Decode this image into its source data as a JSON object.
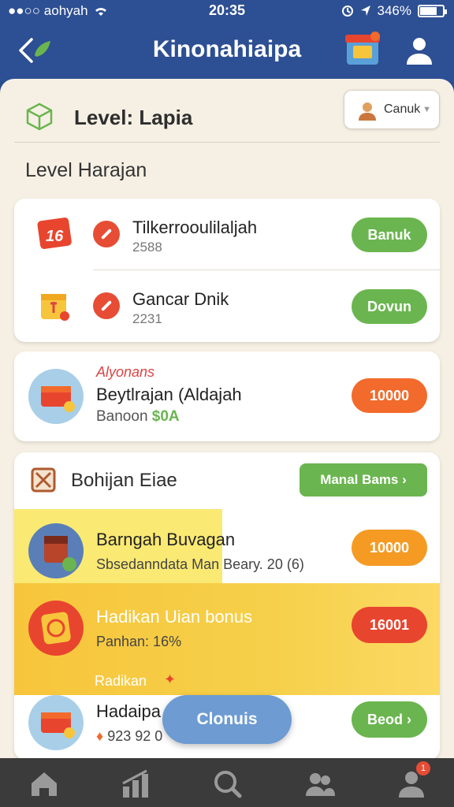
{
  "status": {
    "carrier": "●●○○ aohyah",
    "time": "20:35",
    "battery": "346%",
    "battery_fill_pct": 70
  },
  "header": {
    "title": "Kinonahiaipa"
  },
  "level": {
    "title": "Level: Lapia",
    "dropdown_value": "Canuk"
  },
  "section": {
    "title": "Level Harajan"
  },
  "list1": [
    {
      "title": "Tilkerrooulilaljah",
      "sub": "2588",
      "button": "Banuk",
      "icon": "calendar-16-icon",
      "icon_text": "16"
    },
    {
      "title": "Gancar Dnik",
      "sub": "2231",
      "button": "Dovun",
      "icon": "gift-box-icon"
    }
  ],
  "promo": {
    "tag": "Alyonans",
    "title": "Beytlrajan (Aldajah",
    "sub_label": "Banoon",
    "sub_amount": "$0A",
    "button": "10000"
  },
  "bonus": {
    "title": "Bohijan Eiae",
    "button": "Manal Bams",
    "items": [
      {
        "title": "Barngah Buvagan",
        "sub": "Sbsedanndata Man Beary. 20 (6)",
        "button": "10000",
        "color": "#f59b24"
      },
      {
        "title": "Hadikan Uian bonus",
        "sub": "Panhan: 16%",
        "button": "16001",
        "color": "#e8452f"
      },
      {
        "title": "Hadaipa",
        "sub": "923 92 0",
        "button": "Beod",
        "overlay_label": "Radikan",
        "color": "#6ab54f"
      }
    ]
  },
  "floating_button": "Clonuis",
  "tabs": [
    {
      "name": "home-icon"
    },
    {
      "name": "stats-icon"
    },
    {
      "name": "search-icon"
    },
    {
      "name": "friends-icon"
    },
    {
      "name": "profile-icon",
      "badge": "1"
    }
  ],
  "colors": {
    "primary": "#2d4f93",
    "green": "#6ab54f",
    "orange": "#f26a2c",
    "amber": "#f59b24",
    "red": "#e8452f",
    "highlight": "#f7c53b"
  }
}
